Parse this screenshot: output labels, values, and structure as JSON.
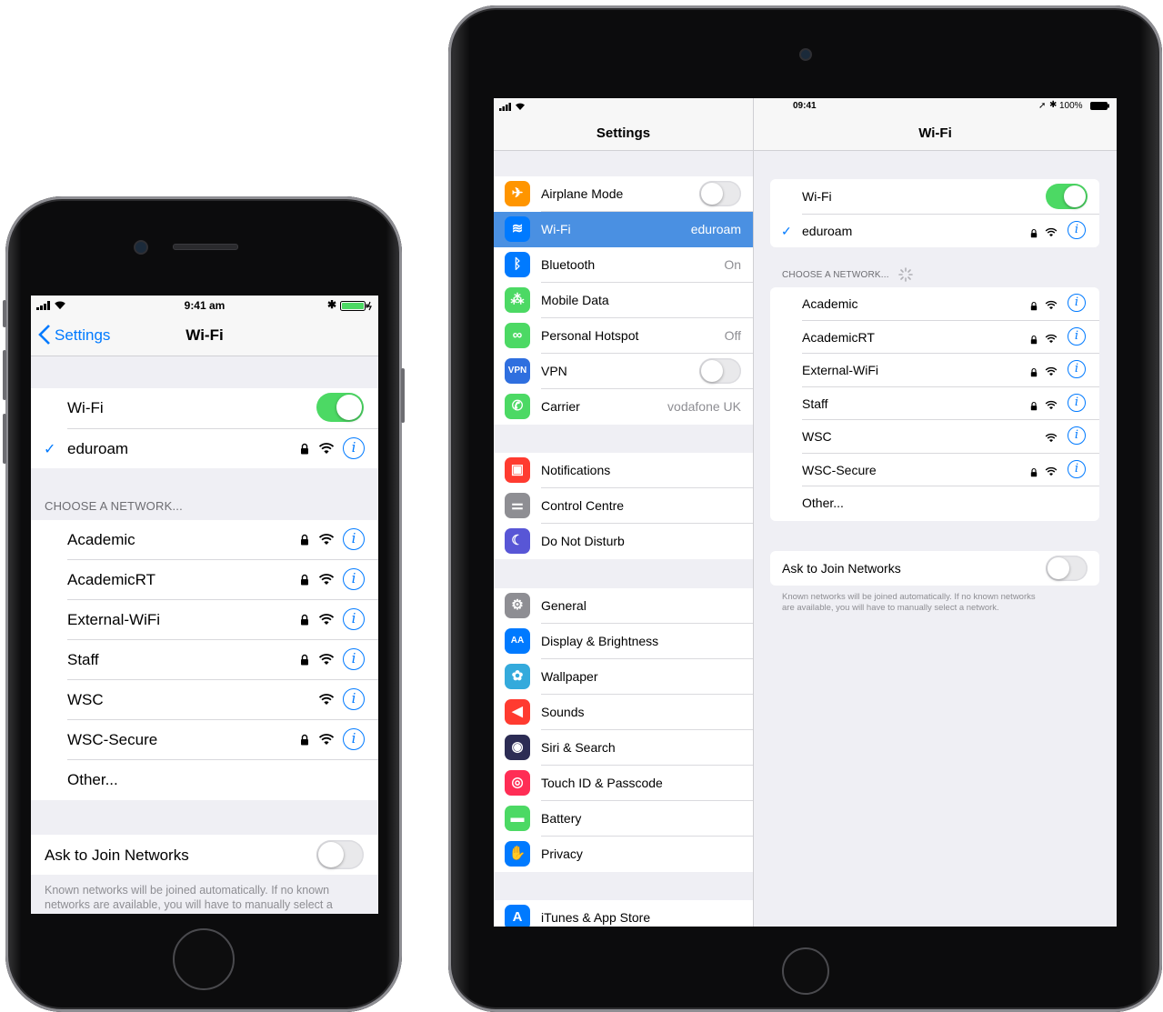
{
  "phone": {
    "status": {
      "time": "9:41 am"
    },
    "nav": {
      "back_label": "Settings",
      "title": "Wi-Fi"
    },
    "wifi_label": "Wi-Fi",
    "wifi_on": true,
    "connected_network": "eduroam",
    "choose_header": "CHOOSE A NETWORK...",
    "networks": [
      {
        "name": "Academic",
        "secured": true
      },
      {
        "name": "AcademicRT",
        "secured": true
      },
      {
        "name": "External-WiFi",
        "secured": true
      },
      {
        "name": "Staff",
        "secured": true
      },
      {
        "name": "WSC",
        "secured": false
      },
      {
        "name": "WSC-Secure",
        "secured": true
      }
    ],
    "other_label": "Other...",
    "ask_join_label": "Ask to Join Networks",
    "ask_join_on": false,
    "footer_line1": "Known networks will be joined automatically. If no known",
    "footer_line2": "networks are available, you will have to manually select a"
  },
  "ipad": {
    "status": {
      "time": "09:41",
      "battery": "100%"
    },
    "sidebar": {
      "title": "Settings",
      "groups": [
        [
          {
            "label": "Airplane Mode",
            "icon": "airplane-icon",
            "color": "#ff9500",
            "type": "toggle",
            "on": false
          },
          {
            "label": "Wi-Fi",
            "icon": "wifi-icon",
            "color": "#007aff",
            "value": "eduroam",
            "selected": true
          },
          {
            "label": "Bluetooth",
            "icon": "bluetooth-icon",
            "color": "#007aff",
            "value": "On"
          },
          {
            "label": "Mobile Data",
            "icon": "antenna-icon",
            "color": "#4cd964",
            "value": ""
          },
          {
            "label": "Personal Hotspot",
            "icon": "hotspot-icon",
            "color": "#4cd964",
            "value": "Off"
          },
          {
            "label": "VPN",
            "icon": "vpn-icon",
            "color": "#2f6fdf",
            "type": "toggle",
            "on": false,
            "glyph": "VPN"
          },
          {
            "label": "Carrier",
            "icon": "phone-icon",
            "color": "#4cd964",
            "value": "vodafone UK"
          }
        ],
        [
          {
            "label": "Notifications",
            "icon": "notifications-icon",
            "color": "#ff3b30",
            "value": ""
          },
          {
            "label": "Control Centre",
            "icon": "control-centre-icon",
            "color": "#8e8e93",
            "value": ""
          },
          {
            "label": "Do Not Disturb",
            "icon": "moon-icon",
            "color": "#5856d6",
            "value": ""
          }
        ],
        [
          {
            "label": "General",
            "icon": "gear-icon",
            "color": "#8e8e93",
            "value": ""
          },
          {
            "label": "Display & Brightness",
            "icon": "display-icon",
            "color": "#007aff",
            "value": "",
            "glyph": "AA"
          },
          {
            "label": "Wallpaper",
            "icon": "wallpaper-icon",
            "color": "#34aadc",
            "value": ""
          },
          {
            "label": "Sounds",
            "icon": "speaker-icon",
            "color": "#ff3b30",
            "value": ""
          },
          {
            "label": "Siri & Search",
            "icon": "siri-icon",
            "color": "#2c2c54",
            "value": ""
          },
          {
            "label": "Touch ID & Passcode",
            "icon": "fingerprint-icon",
            "color": "#ff2d55",
            "value": ""
          },
          {
            "label": "Battery",
            "icon": "battery-icon",
            "color": "#4cd964",
            "value": ""
          },
          {
            "label": "Privacy",
            "icon": "hand-icon",
            "color": "#007aff",
            "value": ""
          }
        ],
        [
          {
            "label": "iTunes & App Store",
            "icon": "app-store-icon",
            "color": "#007aff",
            "value": ""
          }
        ]
      ]
    },
    "detail": {
      "title": "Wi-Fi",
      "wifi_label": "Wi-Fi",
      "wifi_on": true,
      "connected_network": "eduroam",
      "choose_header": "CHOOSE A NETWORK...",
      "networks": [
        {
          "name": "Academic",
          "secured": true
        },
        {
          "name": "AcademicRT",
          "secured": true
        },
        {
          "name": "External-WiFi",
          "secured": true
        },
        {
          "name": "Staff",
          "secured": true
        },
        {
          "name": "WSC",
          "secured": false
        },
        {
          "name": "WSC-Secure",
          "secured": true
        }
      ],
      "other_label": "Other...",
      "ask_join_label": "Ask to Join Networks",
      "ask_join_on": false,
      "footer_line1": "Known networks will be joined automatically. If no known networks",
      "footer_line2": "are available, you will have to manually select a network."
    }
  }
}
